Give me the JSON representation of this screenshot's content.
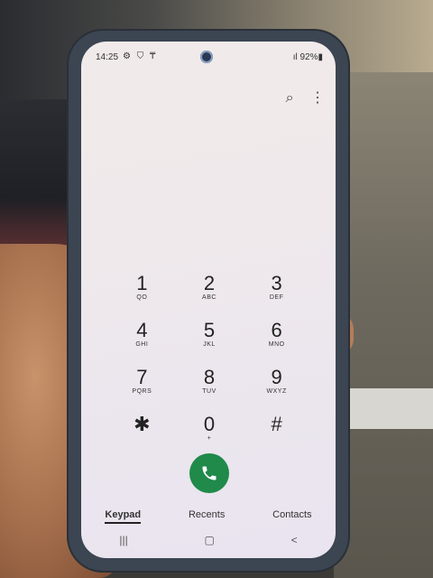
{
  "status_bar": {
    "time": "14:25",
    "icons": "⚙ ⛉ ₸",
    "battery": "ıl 92%▮"
  },
  "top_actions": {
    "search_icon": "⌕",
    "more_icon": "⋮"
  },
  "keypad": [
    {
      "digit": "1",
      "letters": "QO"
    },
    {
      "digit": "2",
      "letters": "ABC"
    },
    {
      "digit": "3",
      "letters": "DEF"
    },
    {
      "digit": "4",
      "letters": "GHI"
    },
    {
      "digit": "5",
      "letters": "JKL"
    },
    {
      "digit": "6",
      "letters": "MNO"
    },
    {
      "digit": "7",
      "letters": "PQRS"
    },
    {
      "digit": "8",
      "letters": "TUV"
    },
    {
      "digit": "9",
      "letters": "WXYZ"
    },
    {
      "digit": "✱",
      "letters": ""
    },
    {
      "digit": "0",
      "letters": "+"
    },
    {
      "digit": "#",
      "letters": ""
    }
  ],
  "tabs": [
    "Keypad",
    "Recents",
    "Contacts"
  ],
  "navbar": {
    "recents": "|||",
    "home": "▢",
    "back": "<"
  },
  "colors": {
    "call_green": "#1f8a4a"
  }
}
